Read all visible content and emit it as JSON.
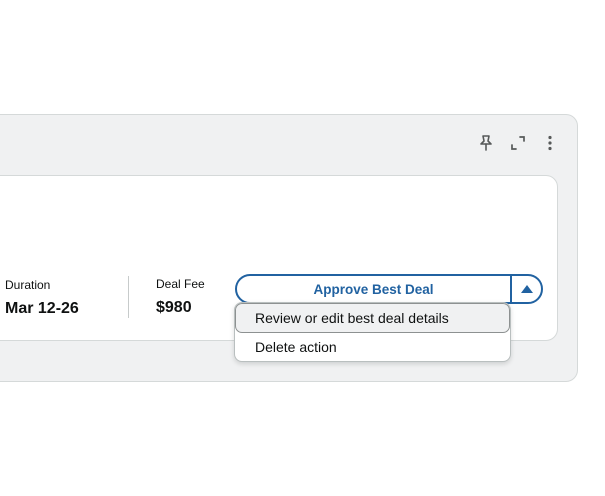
{
  "toolbar": {
    "pin_icon": "pin-icon",
    "expand_icon": "expand-icon",
    "more_icon": "more-vertical-icon"
  },
  "deal": {
    "duration_label": "Duration",
    "duration_value": "Mar 12-26",
    "fee_label": "Deal Fee",
    "fee_value": "$980"
  },
  "action_button": {
    "label": "Approve Best Deal",
    "caret_icon": "caret-up-icon",
    "accent_color": "#2162a1"
  },
  "dropdown": {
    "items": [
      {
        "label": "Review or edit best deal details",
        "active": true
      },
      {
        "label": "Delete action",
        "active": false
      }
    ]
  }
}
